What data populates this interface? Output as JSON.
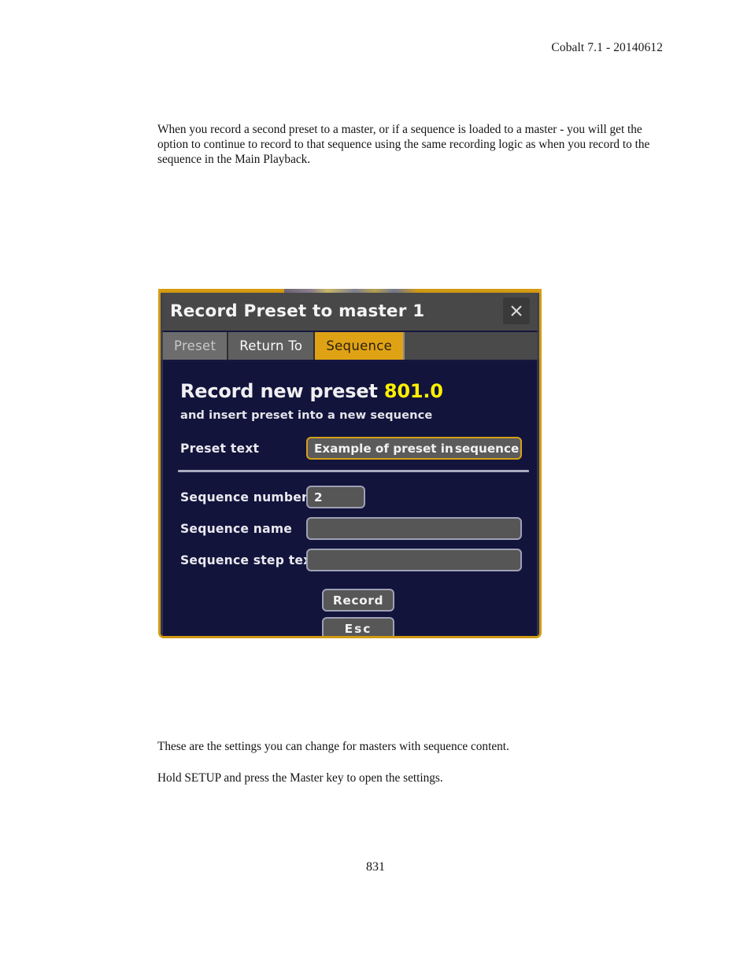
{
  "document": {
    "header": "Cobalt 7.1 - 20140612",
    "paragraphs": {
      "intro": "When you record a second preset to a master, or if a sequence is loaded to a master - you will get the option to continue to record to that sequence using the same recording logic as when you record to the sequence in the Main Playback.",
      "settings": "These are the settings you can change for masters with sequence content.",
      "hold": "Hold SETUP and press the Master key to open the settings."
    },
    "page_number": "831"
  },
  "dialog": {
    "title": "Record Preset to master 1",
    "close_icon": "close-icon",
    "tabs": [
      {
        "label": "Preset",
        "state": "inactive-dim"
      },
      {
        "label": "Return To",
        "state": "inactive-bright"
      },
      {
        "label": "Sequence",
        "state": "active"
      }
    ],
    "headline": {
      "text": "Record new preset",
      "number": "801.0"
    },
    "subline": "and insert preset into a new sequence",
    "fields": [
      {
        "label": "Preset text",
        "value_before_caret": "Example of preset in ",
        "value_after_caret": "sequence...",
        "focused": true
      },
      {
        "label": "Sequence number",
        "value": "2",
        "focused": false
      },
      {
        "label": "Sequence name",
        "value": "",
        "focused": false
      },
      {
        "label": "Sequence step text",
        "value": "",
        "focused": false
      }
    ],
    "buttons": [
      {
        "label": "Record"
      },
      {
        "label": "Esc"
      }
    ],
    "colors": {
      "window_border": "#d29a12",
      "body_background": "#12143c",
      "titlebar": "#484848",
      "active_tab": "#e0a215",
      "accent_number": "#fff000",
      "field_fill": "#565656",
      "field_border": "#9ea0b4",
      "focused_field_border": "#d6a017"
    }
  }
}
